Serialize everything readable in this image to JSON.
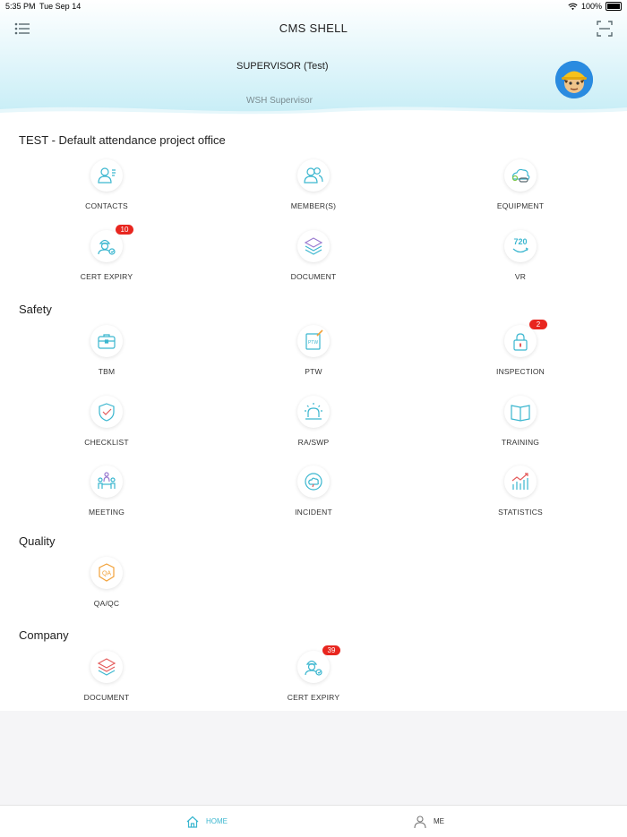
{
  "status_bar": {
    "time": "5:35 PM",
    "date": "Tue Sep 14",
    "battery": "100%"
  },
  "app": {
    "title": "CMS SHELL"
  },
  "user": {
    "name": "SUPERVISOR (Test)",
    "role": "WSH Supervisor"
  },
  "sections": {
    "project": {
      "title": "TEST - Default attendance project office"
    },
    "safety": {
      "title": "Safety"
    },
    "quality": {
      "title": "Quality"
    },
    "company": {
      "title": "Company"
    }
  },
  "tiles": {
    "contacts": "CONTACTS",
    "members": "MEMBER(S)",
    "equipment": "EQUIPMENT",
    "cert_expiry": "CERT EXPIRY",
    "cert_expiry_badge": "10",
    "document": "DOCUMENT",
    "vr": "VR",
    "vr_icon_text": "720",
    "tbm": "TBM",
    "ptw": "PTW",
    "ptw_icon_text": "PTW",
    "inspection": "INSPECTION",
    "inspection_badge": "2",
    "checklist": "CHECKLIST",
    "ra_swp": "RA/SWP",
    "training": "TRAINING",
    "meeting": "MEETING",
    "incident": "INCIDENT",
    "statistics": "STATISTICS",
    "qa_qc": "QA/QC",
    "qa_icon_text": "QA",
    "company_document": "DOCUMENT",
    "company_cert_expiry": "CERT EXPIRY",
    "company_cert_expiry_badge": "39"
  },
  "tabbar": {
    "home": "HOME",
    "me": "ME"
  },
  "colors": {
    "accent": "#3ab6cf",
    "badge": "#e8261f",
    "header_tint": "#c6edf6",
    "doc_red": "#e45b5b",
    "chart_red": "#e45b5b",
    "qa_orange": "#f2a23a"
  }
}
